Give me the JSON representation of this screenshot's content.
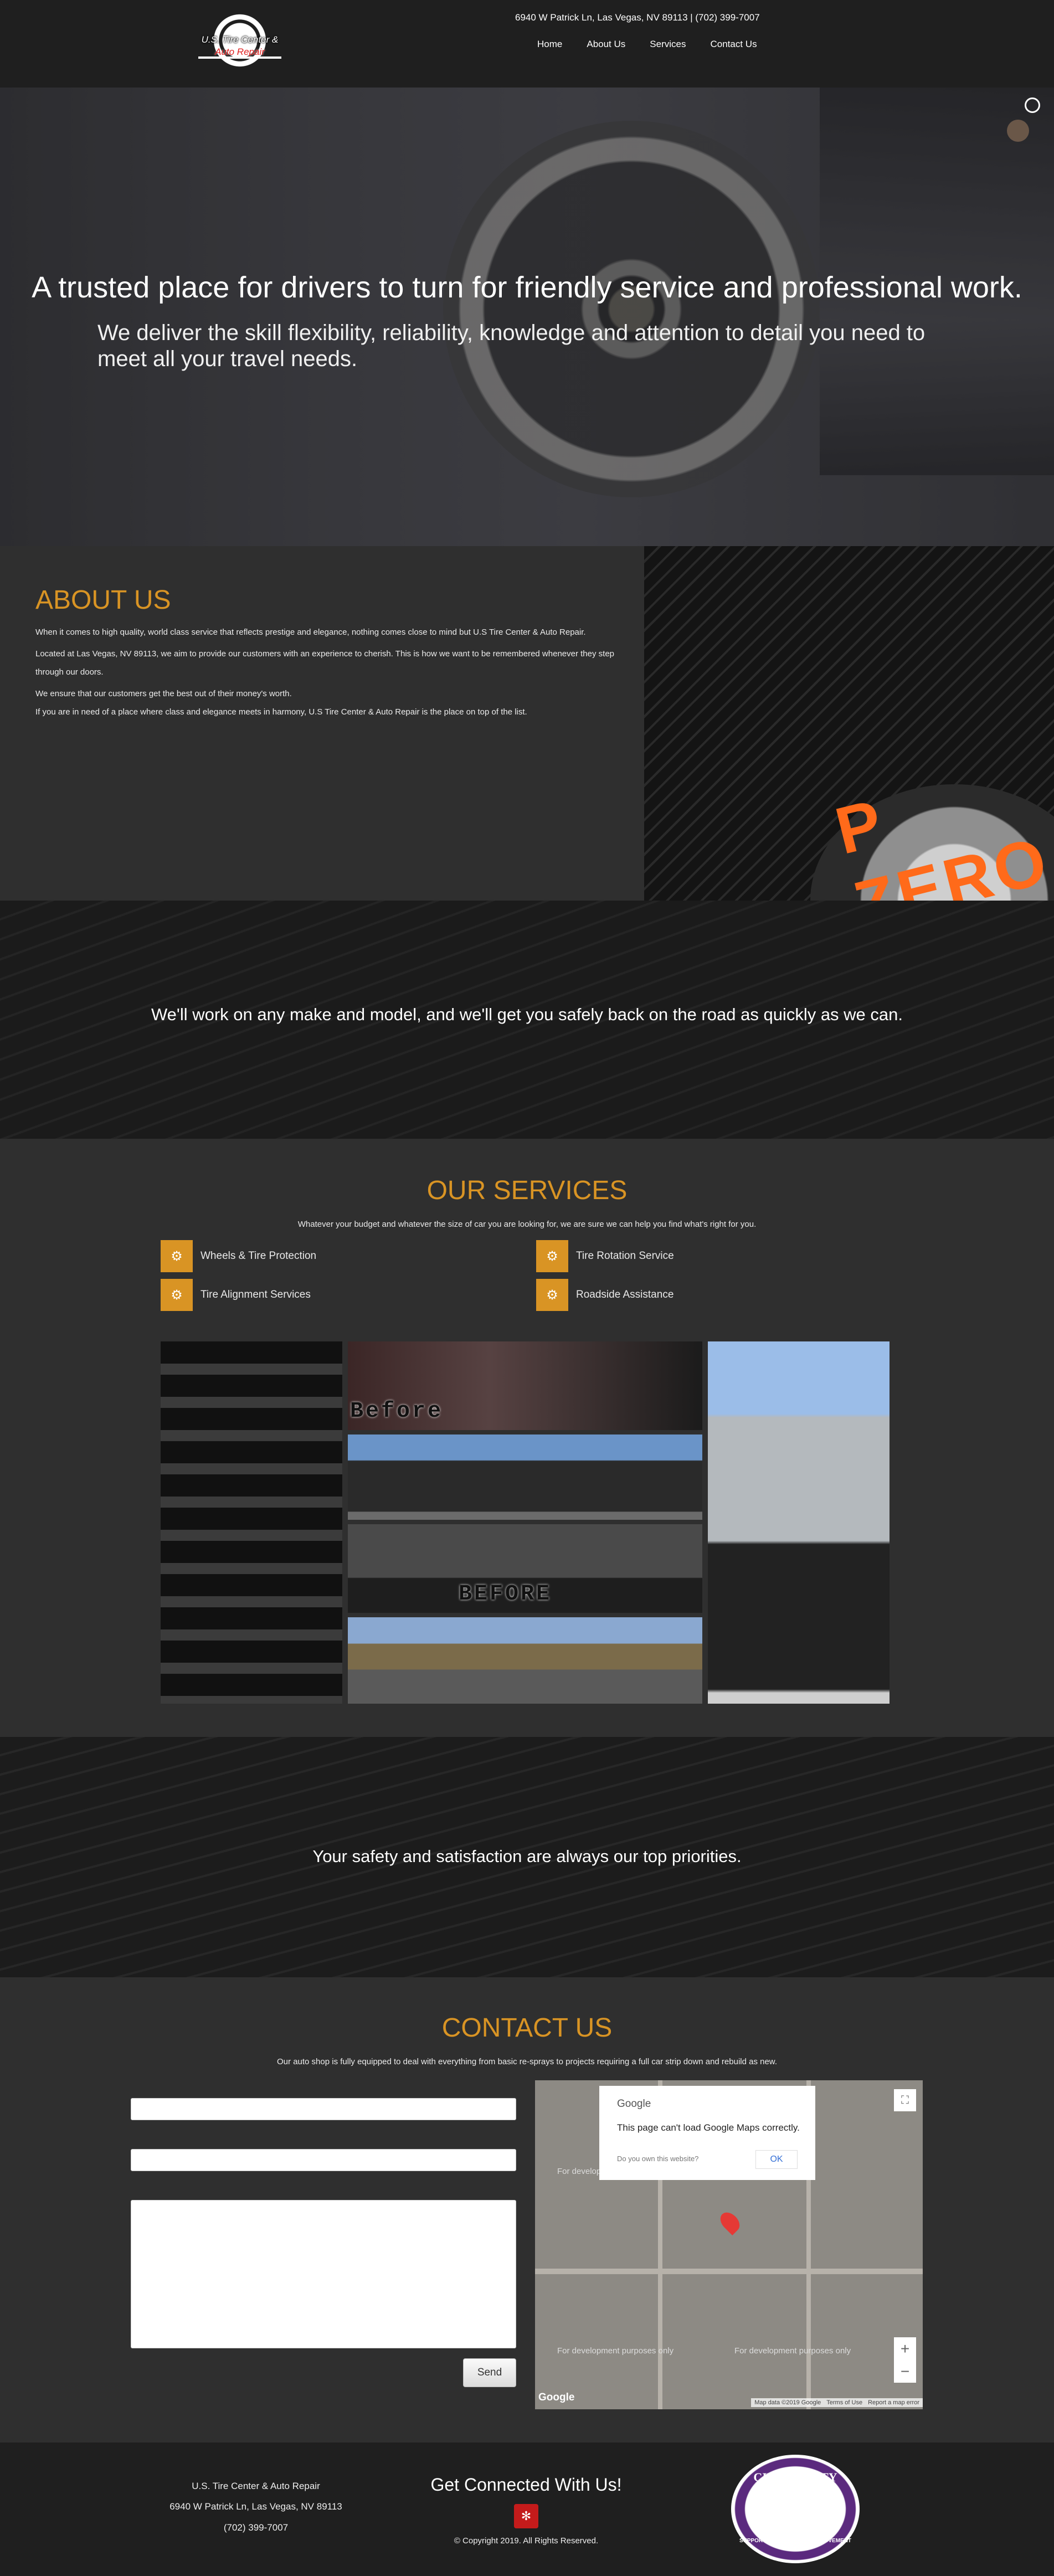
{
  "header": {
    "logo_line1": "U.S. Tire Center &",
    "logo_line2": "Auto Repair",
    "address_line": "6940 W Patrick Ln, Las Vegas, NV 89113 | (702) 399-7007",
    "nav": [
      "Home",
      "About Us",
      "Services",
      "Contact Us"
    ]
  },
  "hero": {
    "headline": "A trusted place for drivers to turn for friendly service and professional work.",
    "subtext": "We deliver the skill flexibility, reliability, knowledge and attention to detail you need to meet all your travel needs."
  },
  "about": {
    "title": "ABOUT US",
    "paragraphs": [
      "When it comes to high quality, world class service that reflects prestige and elegance, nothing comes close to mind but U.S Tire Center & Auto Repair.",
      "Located at Las Vegas, NV 89113, we aim to provide our customers with an experience to cherish. This is how we want to be remembered whenever they step through our doors.",
      "We ensure that our customers get the best out of their money's worth.",
      "If you are in need of a place where class and elegance meets in harmony, U.S Tire Center & Auto Repair is the place on top of the list."
    ],
    "image_text": "P ZERO"
  },
  "band1": {
    "text": "We'll work on any make and model, and we'll get you safely back on the road as quickly as we can."
  },
  "services": {
    "title": "OUR SERVICES",
    "subtitle": "Whatever your budget and whatever the size of car you are looking for, we are sure we can help you find what's right for you.",
    "items": [
      "Wheels & Tire Protection",
      "Tire Rotation Service",
      "Tire Alignment Services",
      "Roadside Assistance"
    ],
    "gallery_labels": [
      "Before",
      "BEFORE"
    ]
  },
  "band2": {
    "text": "Your safety and satisfaction are always our top priorities."
  },
  "contact": {
    "title": "CONTACT US",
    "subtitle": "Our auto shop is fully equipped to deal with everything from basic re-sprays to projects requiring a full car strip down and rebuild as new.",
    "send_label": "Send",
    "map": {
      "dialog_brand": "Google",
      "dialog_message": "This page can't load Google Maps correctly.",
      "dialog_question": "Do you own this website?",
      "ok_label": "OK",
      "dev_text": "For development purposes only",
      "logo": "Google",
      "attribution": [
        "Map data ©2019 Google",
        "Terms of Use",
        "Report a map error"
      ],
      "zoom_in": "+",
      "zoom_out": "−"
    }
  },
  "footer": {
    "name": "U.S. Tire Center & Auto Repair",
    "address": "6940 W Patrick Ln, Las Vegas, NV 89113",
    "phone": "(702) 399-7007",
    "connect_title": "Get Connected With Us!",
    "copyright": "© Copyright 2019. All Rights Reserved.",
    "badge_top": "CITY TO CITY MARKET",
    "badge_bottom": "SUPPORT THE \"BUY LOCAL\" MOVEMENT"
  },
  "colors": {
    "accent": "#d99424",
    "header_bg": "#1f1f1f",
    "section_bg": "#2f2f2f"
  }
}
